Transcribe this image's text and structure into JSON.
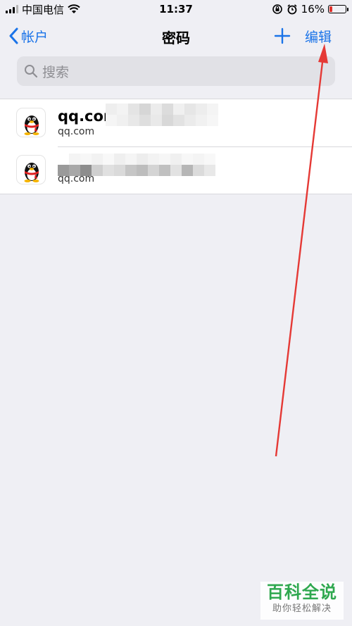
{
  "status_bar": {
    "carrier": "中国电信",
    "time": "11:37",
    "battery_percent_label": "16%",
    "battery_level": 0.16,
    "battery_color": "#e0312b"
  },
  "nav": {
    "back_label": "帐户",
    "title": "密码",
    "add_icon": "plus-icon",
    "edit_label": "编辑",
    "accent_color": "#1a73e8"
  },
  "search": {
    "placeholder": "搜索",
    "icon": "search-icon"
  },
  "accounts": [
    {
      "title": "qq.com",
      "subtitle": "qq.com",
      "icon": "qq-penguin-icon"
    },
    {
      "title": "",
      "subtitle": "qq.com",
      "icon": "qq-penguin-icon"
    }
  ],
  "watermark": {
    "title": "百科全说",
    "subtitle": "助你轻松解决"
  }
}
